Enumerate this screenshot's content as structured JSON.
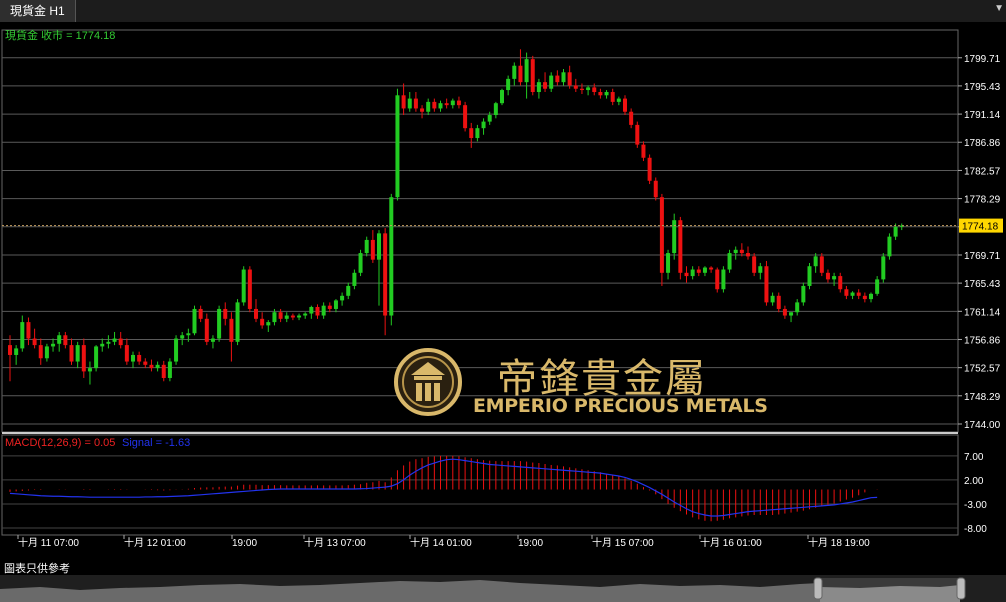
{
  "tab": {
    "title": "現貨金 H1",
    "arrow_icon": "chevron-down-icon"
  },
  "price_panel": {
    "label": "現貨金 收市 = 1774.18",
    "current_price": "1774.18",
    "y_ticks": [
      "1799.71",
      "1795.43",
      "1791.14",
      "1786.86",
      "1782.57",
      "1778.29",
      "1774.00",
      "1769.71",
      "1765.43",
      "1761.14",
      "1756.86",
      "1752.57",
      "1748.29",
      "1744.00"
    ],
    "ylim": [
      1744.0,
      1801.5
    ],
    "colors": {
      "up": "#22cc22",
      "down": "#ee1111",
      "grid": "#5a5a5a",
      "price_line": "#c8a060",
      "label": "#33cc33",
      "axis_text": "#ffe000"
    }
  },
  "macd_panel": {
    "label_macd": "MACD(12,26,9) = 0.05",
    "label_signal": "Signal = -1.63",
    "y_ticks": [
      "7.00",
      "2.00",
      "-3.00",
      "-8.00"
    ],
    "ylim": [
      -8.0,
      8.0
    ],
    "colors": {
      "histogram": "#ee1111",
      "signal": "#2233ee",
      "macd_label": "#ee2222",
      "signal_label": "#2233ee"
    }
  },
  "x_axis": {
    "labels": [
      "十月 11 07:00",
      "十月 12 01:00",
      "19:00",
      "十月 13 07:00",
      "十月 14 01:00",
      "19:00",
      "十月 15 07:00",
      "十月 16 01:00",
      "十月 18 19:00"
    ]
  },
  "logo": {
    "chinese": "帝鋒貴金屬",
    "english": "EMPERIO PRECIOUS METALS",
    "accent": "#d9b86a"
  },
  "footer": {
    "note": "圖表只供參考"
  },
  "chart_data": {
    "type": "candlestick",
    "title": "現貨金 H1",
    "close_label": "現貨金 收市 = 1774.18",
    "x_labels": [
      "十月 11 07:00",
      "十月 12 01:00",
      "19:00",
      "十月 13 07:00",
      "十月 14 01:00",
      "19:00",
      "十月 15 07:00",
      "十月 16 01:00",
      "十月 18 19:00"
    ],
    "ohlc": [
      [
        1756.0,
        1757.5,
        1750.5,
        1754.5
      ],
      [
        1754.5,
        1756.0,
        1753.0,
        1755.5
      ],
      [
        1755.5,
        1760.5,
        1755.0,
        1759.5
      ],
      [
        1759.5,
        1760.2,
        1756.0,
        1757.0
      ],
      [
        1757.0,
        1758.5,
        1755.5,
        1756.0
      ],
      [
        1756.0,
        1757.0,
        1753.0,
        1754.0
      ],
      [
        1754.0,
        1756.2,
        1753.5,
        1755.8
      ],
      [
        1755.8,
        1757.0,
        1755.0,
        1756.2
      ],
      [
        1756.2,
        1758.0,
        1755.0,
        1757.5
      ],
      [
        1757.5,
        1758.0,
        1755.5,
        1756.0
      ],
      [
        1756.0,
        1757.0,
        1753.0,
        1753.5
      ],
      [
        1753.5,
        1756.5,
        1752.5,
        1756.0
      ],
      [
        1756.0,
        1757.0,
        1751.0,
        1752.0
      ],
      [
        1752.0,
        1753.5,
        1750.0,
        1752.5
      ],
      [
        1752.5,
        1756.0,
        1752.0,
        1755.8
      ],
      [
        1755.8,
        1757.0,
        1755.0,
        1756.2
      ],
      [
        1756.2,
        1757.5,
        1755.5,
        1756.5
      ],
      [
        1756.5,
        1758.0,
        1756.0,
        1757.0
      ],
      [
        1757.0,
        1758.0,
        1755.5,
        1756.0
      ],
      [
        1756.0,
        1757.0,
        1753.0,
        1753.5
      ],
      [
        1753.5,
        1755.0,
        1752.5,
        1754.5
      ],
      [
        1754.5,
        1755.0,
        1753.0,
        1753.5
      ],
      [
        1753.5,
        1754.0,
        1752.5,
        1753.0
      ],
      [
        1753.0,
        1753.8,
        1752.0,
        1752.5
      ],
      [
        1752.5,
        1753.5,
        1752.0,
        1753.0
      ],
      [
        1753.0,
        1753.6,
        1750.5,
        1751.0
      ],
      [
        1751.0,
        1754.0,
        1750.5,
        1753.5
      ],
      [
        1753.5,
        1757.5,
        1753.0,
        1757.0
      ],
      [
        1757.0,
        1758.0,
        1756.0,
        1757.5
      ],
      [
        1757.5,
        1758.5,
        1756.5,
        1757.8
      ],
      [
        1757.8,
        1762.0,
        1757.5,
        1761.5
      ],
      [
        1761.5,
        1762.0,
        1759.5,
        1760.0
      ],
      [
        1760.0,
        1760.8,
        1756.0,
        1756.5
      ],
      [
        1756.5,
        1757.5,
        1755.5,
        1757.0
      ],
      [
        1757.0,
        1762.0,
        1756.5,
        1761.5
      ],
      [
        1761.5,
        1762.5,
        1759.0,
        1760.0
      ],
      [
        1760.0,
        1761.0,
        1753.5,
        1756.5
      ],
      [
        1756.5,
        1763.0,
        1756.0,
        1762.5
      ],
      [
        1762.5,
        1768.0,
        1762.0,
        1767.5
      ],
      [
        1767.5,
        1768.0,
        1761.0,
        1761.5
      ],
      [
        1761.5,
        1763.0,
        1759.5,
        1760.0
      ],
      [
        1760.0,
        1761.0,
        1758.5,
        1759.0
      ],
      [
        1759.0,
        1759.8,
        1758.0,
        1759.5
      ],
      [
        1759.5,
        1761.5,
        1759.0,
        1761.0
      ],
      [
        1761.0,
        1761.5,
        1759.5,
        1760.0
      ],
      [
        1760.0,
        1761.0,
        1759.5,
        1760.5
      ],
      [
        1760.5,
        1760.8,
        1759.8,
        1760.2
      ],
      [
        1760.2,
        1760.8,
        1759.8,
        1760.5
      ],
      [
        1760.5,
        1761.0,
        1760.0,
        1760.8
      ],
      [
        1760.8,
        1762.0,
        1760.0,
        1761.8
      ],
      [
        1761.8,
        1762.2,
        1760.0,
        1760.5
      ],
      [
        1760.5,
        1762.5,
        1760.0,
        1762.0
      ],
      [
        1762.0,
        1762.5,
        1761.0,
        1761.5
      ],
      [
        1761.5,
        1763.0,
        1761.0,
        1762.8
      ],
      [
        1762.8,
        1764.0,
        1762.0,
        1763.5
      ],
      [
        1763.5,
        1765.5,
        1763.0,
        1765.0
      ],
      [
        1765.0,
        1767.5,
        1764.5,
        1767.0
      ],
      [
        1767.0,
        1770.5,
        1766.5,
        1770.0
      ],
      [
        1770.0,
        1772.5,
        1769.5,
        1772.0
      ],
      [
        1772.0,
        1773.5,
        1768.5,
        1769.0
      ],
      [
        1769.0,
        1773.5,
        1762.0,
        1773.0
      ],
      [
        1773.0,
        1773.8,
        1757.5,
        1760.5
      ],
      [
        1760.5,
        1779.0,
        1759.0,
        1778.5
      ],
      [
        1778.5,
        1795.0,
        1778.0,
        1794.0
      ],
      [
        1794.0,
        1795.8,
        1791.0,
        1792.0
      ],
      [
        1792.0,
        1794.5,
        1791.5,
        1793.5
      ],
      [
        1793.5,
        1794.5,
        1791.5,
        1792.0
      ],
      [
        1792.0,
        1792.5,
        1790.5,
        1791.5
      ],
      [
        1791.5,
        1793.5,
        1791.0,
        1793.0
      ],
      [
        1793.0,
        1793.5,
        1791.5,
        1792.0
      ],
      [
        1792.0,
        1793.2,
        1791.5,
        1792.8
      ],
      [
        1792.8,
        1793.5,
        1792.0,
        1792.5
      ],
      [
        1792.5,
        1793.5,
        1792.0,
        1793.2
      ],
      [
        1793.2,
        1793.8,
        1792.0,
        1792.5
      ],
      [
        1792.5,
        1793.0,
        1788.5,
        1789.0
      ],
      [
        1789.0,
        1789.8,
        1786.0,
        1787.5
      ],
      [
        1787.5,
        1789.5,
        1787.0,
        1789.0
      ],
      [
        1789.0,
        1790.5,
        1788.0,
        1790.0
      ],
      [
        1790.0,
        1791.5,
        1789.5,
        1791.0
      ],
      [
        1791.0,
        1793.0,
        1790.5,
        1792.8
      ],
      [
        1792.8,
        1795.0,
        1792.5,
        1794.8
      ],
      [
        1794.8,
        1797.0,
        1794.0,
        1796.5
      ],
      [
        1796.5,
        1799.0,
        1795.5,
        1798.5
      ],
      [
        1798.5,
        1801.0,
        1795.5,
        1796.0
      ],
      [
        1796.0,
        1800.5,
        1793.5,
        1799.5
      ],
      [
        1799.5,
        1800.0,
        1794.0,
        1794.5
      ],
      [
        1794.5,
        1796.5,
        1793.5,
        1796.0
      ],
      [
        1796.0,
        1797.5,
        1794.5,
        1795.0
      ],
      [
        1795.0,
        1797.5,
        1794.5,
        1797.0
      ],
      [
        1797.0,
        1797.8,
        1795.5,
        1796.0
      ],
      [
        1796.0,
        1798.0,
        1795.5,
        1797.5
      ],
      [
        1797.5,
        1798.5,
        1795.0,
        1795.5
      ],
      [
        1795.5,
        1796.5,
        1794.5,
        1795.0
      ],
      [
        1795.0,
        1795.8,
        1794.2,
        1794.8
      ],
      [
        1794.8,
        1795.5,
        1794.0,
        1795.2
      ],
      [
        1795.2,
        1795.8,
        1794.0,
        1794.5
      ],
      [
        1794.5,
        1795.0,
        1793.5,
        1794.0
      ],
      [
        1794.0,
        1794.8,
        1793.5,
        1794.5
      ],
      [
        1794.5,
        1795.0,
        1792.5,
        1793.0
      ],
      [
        1793.0,
        1793.8,
        1792.5,
        1793.5
      ],
      [
        1793.5,
        1794.0,
        1791.0,
        1791.5
      ],
      [
        1791.5,
        1792.0,
        1789.0,
        1789.5
      ],
      [
        1789.5,
        1790.0,
        1786.0,
        1786.5
      ],
      [
        1786.5,
        1787.0,
        1784.0,
        1784.5
      ],
      [
        1784.5,
        1785.0,
        1780.5,
        1781.0
      ],
      [
        1781.0,
        1781.5,
        1778.0,
        1778.5
      ],
      [
        1778.5,
        1779.0,
        1765.0,
        1767.0
      ],
      [
        1767.0,
        1770.5,
        1766.0,
        1770.0
      ],
      [
        1770.0,
        1776.0,
        1769.0,
        1775.0
      ],
      [
        1775.0,
        1775.5,
        1766.0,
        1767.0
      ],
      [
        1767.0,
        1768.0,
        1765.5,
        1766.5
      ],
      [
        1766.5,
        1768.0,
        1766.0,
        1767.5
      ],
      [
        1767.5,
        1768.0,
        1766.5,
        1767.0
      ],
      [
        1767.0,
        1768.0,
        1766.5,
        1767.8
      ],
      [
        1767.8,
        1768.0,
        1767.0,
        1767.5
      ],
      [
        1767.5,
        1767.8,
        1764.0,
        1764.5
      ],
      [
        1764.5,
        1768.0,
        1764.0,
        1767.5
      ],
      [
        1767.5,
        1770.5,
        1767.0,
        1770.0
      ],
      [
        1770.0,
        1771.0,
        1769.0,
        1770.5
      ],
      [
        1770.5,
        1771.5,
        1769.5,
        1770.0
      ],
      [
        1770.0,
        1771.0,
        1769.0,
        1769.5
      ],
      [
        1769.5,
        1770.0,
        1766.5,
        1767.0
      ],
      [
        1767.0,
        1768.5,
        1766.0,
        1768.0
      ],
      [
        1768.0,
        1768.8,
        1762.0,
        1762.5
      ],
      [
        1762.5,
        1764.0,
        1762.0,
        1763.5
      ],
      [
        1763.5,
        1764.0,
        1761.0,
        1761.5
      ],
      [
        1761.5,
        1762.0,
        1760.0,
        1760.5
      ],
      [
        1760.5,
        1761.0,
        1759.5,
        1761.0
      ],
      [
        1761.0,
        1763.0,
        1760.5,
        1762.5
      ],
      [
        1762.5,
        1765.5,
        1762.0,
        1765.0
      ],
      [
        1765.0,
        1768.5,
        1764.5,
        1768.0
      ],
      [
        1768.0,
        1770.0,
        1767.0,
        1769.5
      ],
      [
        1769.5,
        1770.0,
        1766.5,
        1767.0
      ],
      [
        1767.0,
        1767.5,
        1765.5,
        1766.0
      ],
      [
        1766.0,
        1767.0,
        1765.0,
        1766.5
      ],
      [
        1766.5,
        1767.0,
        1764.0,
        1764.5
      ],
      [
        1764.5,
        1765.0,
        1763.0,
        1763.5
      ],
      [
        1763.5,
        1764.2,
        1763.0,
        1764.0
      ],
      [
        1764.0,
        1764.5,
        1763.0,
        1763.5
      ],
      [
        1763.5,
        1764.0,
        1762.5,
        1763.0
      ],
      [
        1763.0,
        1764.0,
        1762.5,
        1763.8
      ],
      [
        1763.8,
        1766.5,
        1763.5,
        1766.0
      ],
      [
        1766.0,
        1770.0,
        1765.5,
        1769.5
      ],
      [
        1769.5,
        1773.0,
        1769.0,
        1772.5
      ],
      [
        1772.5,
        1774.5,
        1772.0,
        1774.0
      ],
      [
        1774.0,
        1774.5,
        1773.5,
        1774.18
      ]
    ],
    "macd_histogram": [
      -0.5,
      -0.4,
      -0.3,
      -0.2,
      -0.1,
      -0.1,
      0.0,
      0.0,
      0.05,
      0.05,
      0.0,
      0.0,
      -0.1,
      -0.1,
      0.0,
      0.0,
      0.05,
      0.1,
      0.1,
      0.05,
      0.0,
      0.0,
      -0.05,
      -0.1,
      -0.15,
      -0.2,
      -0.15,
      -0.05,
      0.05,
      0.15,
      0.3,
      0.4,
      0.45,
      0.45,
      0.55,
      0.6,
      0.6,
      0.8,
      1.0,
      1.0,
      1.0,
      0.9,
      0.9,
      0.9,
      0.9,
      0.85,
      0.85,
      0.85,
      0.85,
      0.85,
      0.85,
      0.85,
      0.85,
      0.85,
      0.85,
      0.9,
      1.0,
      1.1,
      1.4,
      1.5,
      1.8,
      1.5,
      2.5,
      4.0,
      5.0,
      5.8,
      6.3,
      6.5,
      6.8,
      6.9,
      7.0,
      7.0,
      7.0,
      6.9,
      6.7,
      6.5,
      6.3,
      6.1,
      6.0,
      5.9,
      5.9,
      5.9,
      5.9,
      5.9,
      5.8,
      5.6,
      5.5,
      5.3,
      5.1,
      5.0,
      4.8,
      4.6,
      4.4,
      4.2,
      4.0,
      3.8,
      3.6,
      3.3,
      3.0,
      2.7,
      2.3,
      1.8,
      1.2,
      0.5,
      -0.2,
      -1.0,
      -2.0,
      -3.0,
      -3.8,
      -4.5,
      -5.2,
      -5.8,
      -6.2,
      -6.5,
      -6.6,
      -6.5,
      -6.3,
      -6.0,
      -5.8,
      -5.6,
      -5.4,
      -5.3,
      -5.3,
      -5.3,
      -5.3,
      -5.2,
      -5.0,
      -4.8,
      -4.6,
      -4.4,
      -4.1,
      -3.8,
      -3.5,
      -3.2,
      -2.9,
      -2.5,
      -2.1,
      -1.7,
      -1.2,
      -0.6,
      0.0,
      0.05
    ],
    "signal_line": [
      -0.8,
      -0.9,
      -1.0,
      -1.1,
      -1.2,
      -1.3,
      -1.35,
      -1.4,
      -1.4,
      -1.45,
      -1.5,
      -1.5,
      -1.55,
      -1.6,
      -1.6,
      -1.6,
      -1.6,
      -1.6,
      -1.6,
      -1.6,
      -1.6,
      -1.6,
      -1.55,
      -1.55,
      -1.5,
      -1.5,
      -1.45,
      -1.4,
      -1.35,
      -1.3,
      -1.2,
      -1.1,
      -1.0,
      -0.9,
      -0.8,
      -0.7,
      -0.6,
      -0.5,
      -0.4,
      -0.3,
      -0.2,
      -0.1,
      0.0,
      0.05,
      0.1,
      0.1,
      0.1,
      0.1,
      0.1,
      0.1,
      0.1,
      0.1,
      0.1,
      0.1,
      0.1,
      0.1,
      0.1,
      0.15,
      0.2,
      0.3,
      0.4,
      0.5,
      0.7,
      1.2,
      2.0,
      3.0,
      3.8,
      4.5,
      5.1,
      5.5,
      5.9,
      6.2,
      6.3,
      6.2,
      6.0,
      5.8,
      5.6,
      5.4,
      5.2,
      5.1,
      5.0,
      4.9,
      4.8,
      4.7,
      4.6,
      4.5,
      4.4,
      4.3,
      4.2,
      4.1,
      4.0,
      3.9,
      3.8,
      3.7,
      3.6,
      3.5,
      3.4,
      3.2,
      3.0,
      2.8,
      2.5,
      2.1,
      1.6,
      1.0,
      0.4,
      -0.3,
      -1.0,
      -1.8,
      -2.6,
      -3.3,
      -4.0,
      -4.6,
      -5.0,
      -5.3,
      -5.5,
      -5.5,
      -5.4,
      -5.2,
      -5.0,
      -4.8,
      -4.6,
      -4.5,
      -4.4,
      -4.3,
      -4.2,
      -4.1,
      -4.0,
      -3.9,
      -3.8,
      -3.7,
      -3.6,
      -3.5,
      -3.4,
      -3.3,
      -3.2,
      -3.0,
      -2.8,
      -2.6,
      -2.3,
      -2.0,
      -1.7,
      -1.63
    ]
  }
}
